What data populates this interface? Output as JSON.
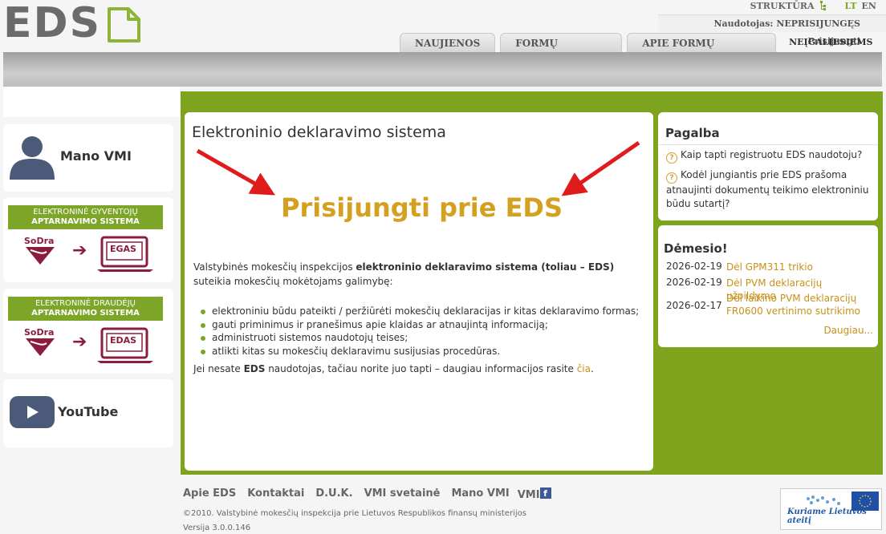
{
  "header": {
    "logo_text": "EDS",
    "structure_link": "STRUKTŪRA",
    "lang_lt": "LT",
    "lang_en": "EN",
    "user_prefix": "Naudotojas:",
    "user_status": "NEPRISIJUNGĘS",
    "login_link": "Prisijungti",
    "tabs": [
      "NAUJIENOS",
      "FORMŲ SĄRAŠAS",
      "APIE FORMŲ TEIKIMĄ"
    ],
    "disabled_link": "NEĮGALIESIEMS",
    "colors": {
      "accent": "#7ea31c",
      "link": "#c8901a",
      "title": "#d4a020"
    }
  },
  "left": {
    "mano_vmi": "Mano VMI",
    "banner1": {
      "line1": "ELEKTRONINĖ GYVENTOJŲ",
      "line2": "APTARNAVIMO SISTEMA",
      "sodra": "SoDra",
      "system": "EGAS"
    },
    "banner2": {
      "line1": "ELEKTRONINĖ DRAUDĖJŲ",
      "line2": "APTARNAVIMO SISTEMA",
      "sodra": "SoDra",
      "system": "EDAS"
    },
    "youtube": "YouTube"
  },
  "main": {
    "title": "Elektroninio deklaravimo sistema",
    "login_big": "Prisijungti prie EDS",
    "intro_a": "Valstybinės mokesčių inspekcijos ",
    "intro_b": "elektroninio deklaravimo sistema (toliau – EDS)",
    "intro_c": " suteikia mokesčių mokėtojams galimybę:",
    "bullets": [
      "elektroniniu būdu pateikti / peržiūrėti mokesčių deklaracijas ir kitas deklaravimo formas;",
      "gauti priminimus ir pranešimus apie klaidas ar atnaujintą informaciją;",
      "administruoti sistemos naudotojų teises;",
      "atlikti kitas su mokesčių deklaravimu susijusias procedūras."
    ],
    "foot_a": "Jei nesate ",
    "foot_b": "EDS",
    "foot_c": " naudotojas, tačiau norite juo tapti – daugiau informacijos rasite ",
    "foot_link": "čia",
    "foot_end": "."
  },
  "help": {
    "title": "Pagalba",
    "q1": "Kaip tapti registruotu EDS naudotoju?",
    "q2": "Kodėl jungiantis prie EDS prašoma atnaujinti dokumentų teikimo elektroniniu būdu sutartį?"
  },
  "attention": {
    "title": "Dėmesio!",
    "items": [
      {
        "date": "2026-02-19",
        "text": "Dėl GPM311 trikio"
      },
      {
        "date": "2026-02-19",
        "text": "Dėl PVM deklaracijų užpildymo"
      },
      {
        "date": "2026-02-17",
        "text": "Dėl laikino PVM deklaracijų FR0600 vertinimo sutrikimo"
      }
    ],
    "more": "Daugiau..."
  },
  "footer": {
    "links": [
      "Apie EDS",
      "Kontaktai",
      "D.U.K.",
      "VMI svetainė",
      "Mano VMI",
      "VMI"
    ],
    "copyright": "©2010. Valstybinė mokesčių inspekcija prie Lietuvos Respublikos finansų ministerijos",
    "version": "Versija 3.0.0.146",
    "eu_slogan": "Kuriame Lietuvos ateitį"
  }
}
